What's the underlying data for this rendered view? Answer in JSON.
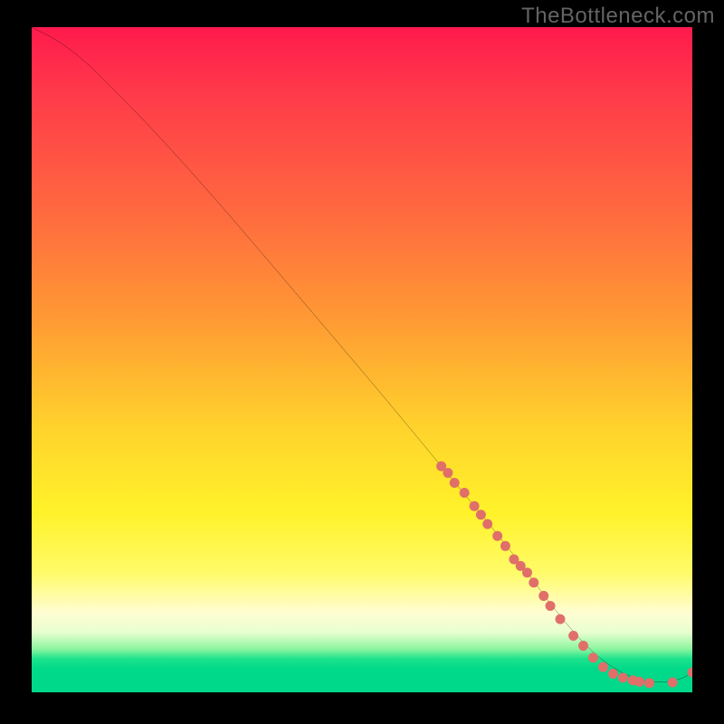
{
  "watermark": "TheBottleneck.com",
  "chart_data": {
    "type": "line",
    "title": "",
    "xlabel": "",
    "ylabel": "",
    "xlim": [
      0,
      100
    ],
    "ylim": [
      0,
      100
    ],
    "grid": false,
    "legend": false,
    "annotations": [],
    "series": [
      {
        "name": "curve",
        "color": "#000000",
        "x": [
          0,
          4,
          8,
          12,
          18,
          28,
          40,
          52,
          62,
          72,
          78,
          82,
          86,
          90,
          94,
          98,
          100
        ],
        "y": [
          100,
          98,
          95,
          91,
          85,
          74,
          60,
          46,
          34,
          22,
          14,
          9,
          5,
          2.5,
          1.4,
          1.8,
          3
        ]
      },
      {
        "name": "points",
        "color": "#e06f6a",
        "type": "scatter",
        "x": [
          62,
          63,
          64,
          65.5,
          67,
          68,
          69,
          70.5,
          71.7,
          73,
          74,
          75,
          76,
          77.5,
          78.5,
          80,
          82,
          83.5,
          85,
          86.5,
          88,
          89.5,
          91,
          92,
          93.5,
          97,
          100
        ],
        "y": [
          34,
          33,
          31.5,
          30,
          28,
          26.7,
          25.3,
          23.5,
          22,
          20,
          19,
          18,
          16.5,
          14.5,
          13,
          11,
          8.5,
          7,
          5.2,
          3.8,
          2.8,
          2.2,
          1.8,
          1.6,
          1.4,
          1.5,
          3
        ]
      }
    ],
    "gradient_stops": [
      {
        "pos": 0.0,
        "color": "#ff1a4d"
      },
      {
        "pos": 0.28,
        "color": "#ff6a3f"
      },
      {
        "pos": 0.6,
        "color": "#ffd22c"
      },
      {
        "pos": 0.82,
        "color": "#fffb68"
      },
      {
        "pos": 0.95,
        "color": "#1be28c"
      },
      {
        "pos": 1.0,
        "color": "#00d98a"
      }
    ]
  }
}
